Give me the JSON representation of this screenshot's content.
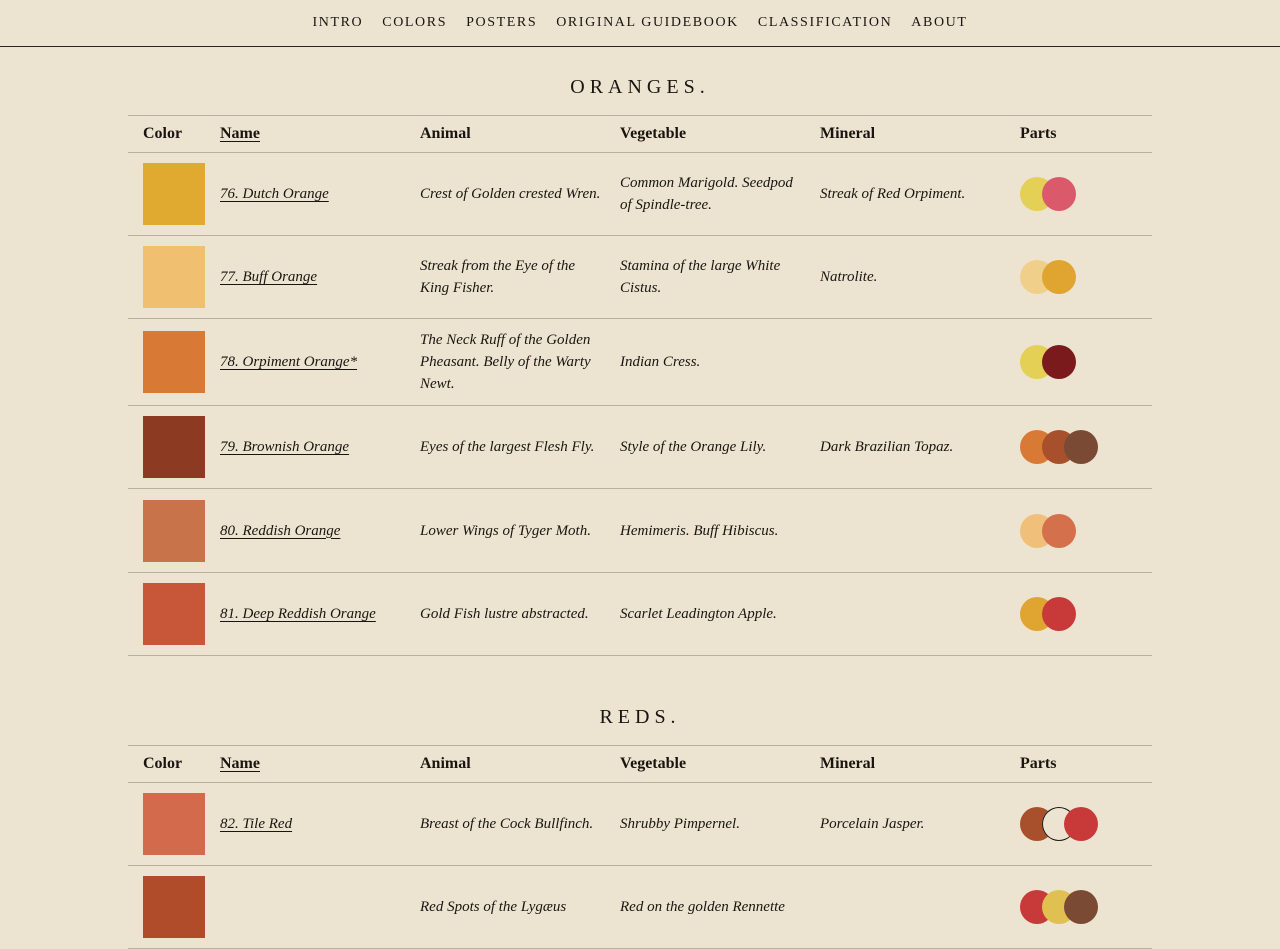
{
  "nav": [
    "Intro",
    "Colors",
    "Posters",
    "Original Guidebook",
    "Classification",
    "About"
  ],
  "columns": {
    "color": "Color",
    "name": "Name",
    "animal": "Animal",
    "vegetable": "Vegetable",
    "mineral": "Mineral",
    "parts": "Parts"
  },
  "oranges": {
    "title": "ORANGES.",
    "rows": [
      {
        "swatch": "#e0a930",
        "name": "76. Dutch Orange",
        "animal": "Crest of Golden crested Wren.",
        "vegetable": "Common Marigold. Seedpod of Spindle-tree.",
        "mineral": "Streak of Red Orpiment.",
        "parts": [
          "#e4d055",
          "#da5a6c"
        ]
      },
      {
        "swatch": "#f0c070",
        "name": "77. Buff Orange",
        "animal": "Streak from the Eye of the King Fisher.",
        "vegetable": "Stamina of the large White Cistus.",
        "mineral": "Natrolite.",
        "parts": [
          "#f0cf8a",
          "#e0a430"
        ]
      },
      {
        "swatch": "#d87a36",
        "name": "78. Orpiment Orange*",
        "animal": "The Neck Ruff of the Golden Pheasant. Belly of the Warty Newt.",
        "vegetable": "Indian Cress.",
        "mineral": "",
        "parts": [
          "#e4d055",
          "#7a1a1c"
        ]
      },
      {
        "swatch": "#8c3a22",
        "name": "79. Brownish Orange",
        "animal": "Eyes of the largest Flesh Fly.",
        "vegetable": "Style of the Orange Lily.",
        "mineral": "Dark Brazilian Topaz.",
        "parts": [
          "#d87a36",
          "#a8502c",
          "#7a4a35"
        ]
      },
      {
        "swatch": "#c9734a",
        "name": "80. Reddish Orange",
        "animal": "Lower Wings of Tyger Moth.",
        "vegetable": "Hemimeris. Buff Hibiscus.",
        "mineral": "",
        "parts": [
          "#f0c07a",
          "#d4704c"
        ]
      },
      {
        "swatch": "#c8573a",
        "name": "81. Deep Reddish Orange",
        "animal": "Gold Fish lustre abstracted.",
        "vegetable": "Scarlet Leadington Apple.",
        "mineral": "",
        "parts": [
          "#e0a430",
          "#c83a3a"
        ]
      }
    ]
  },
  "reds": {
    "title": "REDS.",
    "rows": [
      {
        "swatch": "#d46a4c",
        "name": "82. Tile Red",
        "animal": "Breast of the Cock Bullfinch.",
        "vegetable": "Shrubby Pimpernel.",
        "mineral": "Porcelain Jasper.",
        "parts": [
          "#a8502c",
          "#ece4d0",
          "#c83a3a"
        ]
      },
      {
        "swatch": "#b04c2a",
        "name": "",
        "animal": "Red Spots of the Lygæus",
        "vegetable": "Red on the golden Rennette",
        "mineral": "",
        "parts": [
          "#c83a3a",
          "#e0c050",
          "#7a4a35"
        ]
      }
    ]
  }
}
